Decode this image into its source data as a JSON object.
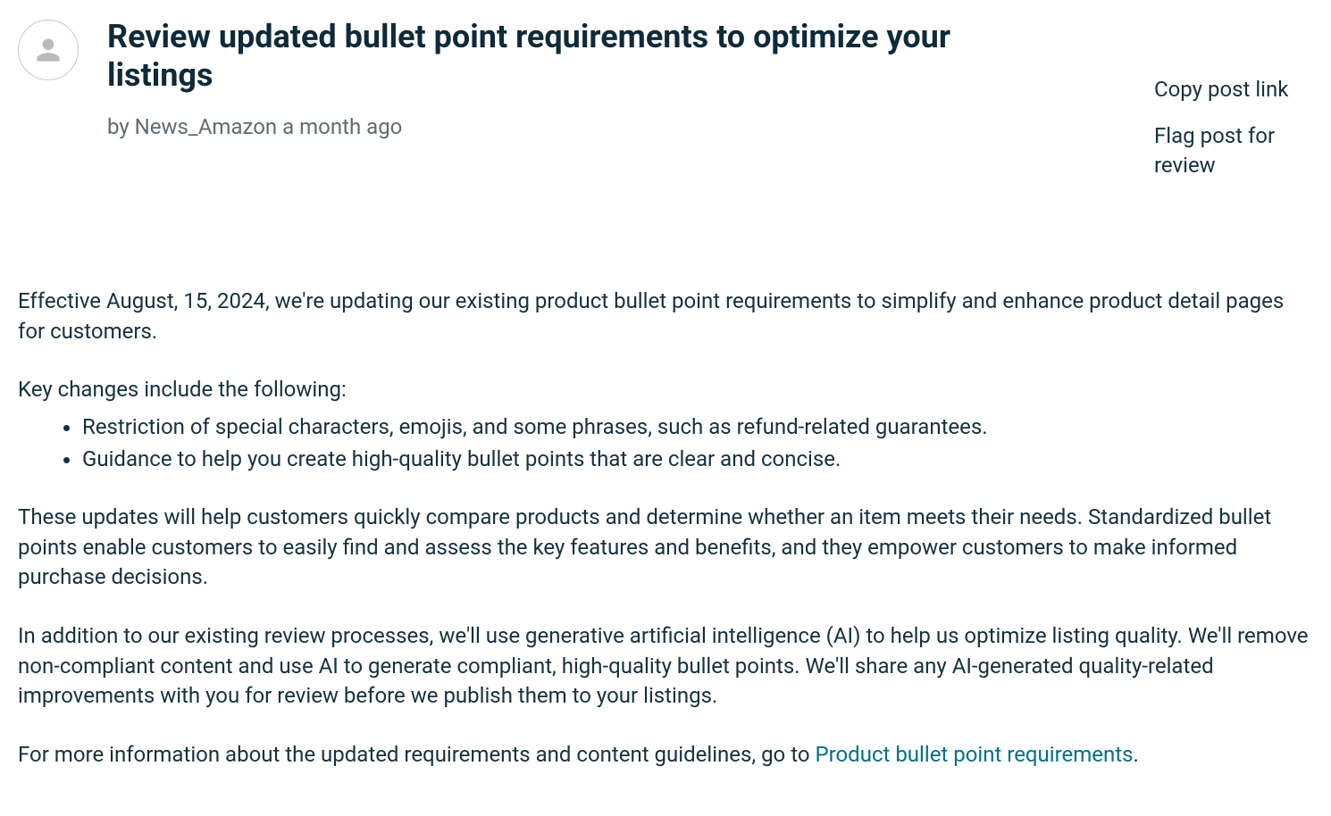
{
  "post": {
    "title": "Review updated bullet point requirements to optimize your listings",
    "byline_prefix": "by",
    "author": "News_Amazon",
    "time_ago": "a month ago"
  },
  "actions": {
    "copy_link": "Copy post link",
    "flag": "Flag post for review"
  },
  "body": {
    "p1": "Effective August, 15, 2024, we're updating our existing product bullet point requirements to simplify and enhance product detail pages for customers.",
    "p2": "Key changes include the following:",
    "bullets": [
      "Restriction of special characters, emojis, and some phrases, such as refund-related guarantees.",
      "Guidance to help you create high-quality bullet points that are clear and concise."
    ],
    "p3": "These updates will help customers quickly compare products and determine whether an item meets their needs. Standardized bullet points enable customers to easily find and assess the key features and benefits, and they empower customers to make informed purchase decisions.",
    "p4": "In addition to our existing review processes, we'll use generative artificial intelligence (AI) to help us optimize listing quality. We'll remove non-compliant content and use AI to generate compliant, high-quality bullet points. We'll share any AI-generated quality-related improvements with you for review before we publish them to your listings.",
    "p5_prefix": "For more information about the updated requirements and content guidelines, go to ",
    "p5_link": "Product bullet point requirements",
    "p5_suffix": "."
  }
}
